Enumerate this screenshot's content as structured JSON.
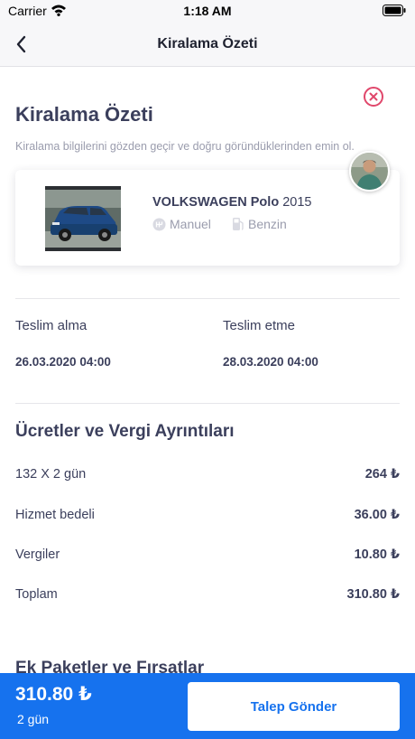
{
  "status_bar": {
    "carrier": "Carrier",
    "time": "1:18 AM"
  },
  "nav": {
    "title": "Kiralama Özeti"
  },
  "header": {
    "title": "Kiralama Özeti",
    "subtitle": "Kiralama bilgilerini gözden geçir ve doğru göründüklerinden emin ol."
  },
  "car": {
    "brand": "VOLKSWAGEN Polo",
    "year": "2015",
    "transmission": "Manuel",
    "fuel": "Benzin"
  },
  "dates": {
    "pickup_label": "Teslim alma",
    "pickup_value": "26.03.2020 04:00",
    "dropoff_label": "Teslim etme",
    "dropoff_value": "28.03.2020 04:00"
  },
  "fees": {
    "title": "Ücretler ve Vergi Ayrıntıları",
    "rows": [
      {
        "label": "132 X 2 gün",
        "amount": "264 ₺"
      },
      {
        "label": "Hizmet bedeli",
        "amount": "36.00 ₺"
      },
      {
        "label": "Vergiler",
        "amount": "10.80 ₺"
      },
      {
        "label": "Toplam",
        "amount": "310.80 ₺"
      }
    ]
  },
  "extras": {
    "title": "Ek Paketler ve Fırsatlar"
  },
  "footer": {
    "total": "310.80 ₺",
    "days": "2 gün",
    "button_label": "Talep Gönder"
  },
  "colors": {
    "accent": "#1672ee",
    "close": "#e0476b",
    "text": "#3b3f5c",
    "muted": "#9a9cad"
  }
}
